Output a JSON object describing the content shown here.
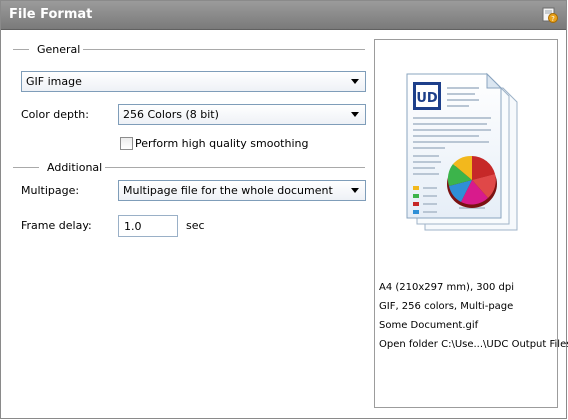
{
  "window": {
    "title": "File Format"
  },
  "icons": {
    "help": "help-icon",
    "document_preview": "document-preview-icon",
    "dropdown": "chevron-down-icon"
  },
  "general": {
    "group_title": "General",
    "format_value": "GIF image",
    "color_depth_label": "Color depth:",
    "color_depth_value": "256 Colors (8 bit)",
    "smoothing_label": "Perform high quality smoothing",
    "smoothing_checked": false
  },
  "additional": {
    "group_title": "Additional",
    "multipage_label": "Multipage:",
    "multipage_value": "Multipage file for the whole document",
    "frame_delay_label": "Frame delay:",
    "frame_delay_value": "1.0",
    "frame_delay_unit": "sec"
  },
  "preview": {
    "lines": [
      "A4 (210x297 mm), 300 dpi",
      "GIF, 256 colors, Multi-page",
      "Some Document.gif",
      "Open folder C:\\Use...\\UDC Output Files\\"
    ],
    "logo_text": "UD"
  },
  "colors": {
    "titlebar": "#8a8a8a",
    "pie": [
      "#c62828",
      "#f2b81d",
      "#2f8fd6",
      "#d81b8c",
      "#3cb44b"
    ]
  }
}
